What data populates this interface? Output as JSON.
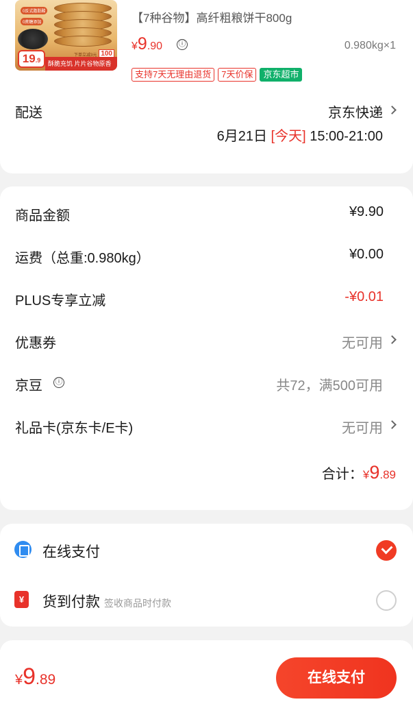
{
  "product": {
    "title": "【7种谷物】高纤粗粮饼干800g",
    "price_symbol": "¥",
    "price_int": "9",
    "price_dec": ".90",
    "weight_qty": "0.980kg×1",
    "tags": [
      "支持7天无理由退货",
      "7天价保",
      "京东超市"
    ],
    "image": {
      "badge_int": "19",
      "badge_dec": ".9",
      "promo_small": "下单立减3元",
      "promo_100": "100",
      "promo_bar": "酥脆充饥 片片谷物原香",
      "tag1": "0反式脂肪酸",
      "tag2": "0蔗糖添加"
    }
  },
  "delivery": {
    "label": "配送",
    "carrier": "京东快递",
    "date": "6月21日",
    "today": "[今天]",
    "window": "15:00-21:00"
  },
  "summary": {
    "rows": [
      {
        "label": "商品金额",
        "value": "¥9.90"
      },
      {
        "label": "运费（总重:0.980kg）",
        "value": "¥0.00"
      },
      {
        "label": "PLUS专享立减",
        "value": "-¥0.01"
      },
      {
        "label": "优惠券",
        "value": "无可用"
      },
      {
        "label": "京豆",
        "value": "共72，满500可用"
      },
      {
        "label": "礼品卡(京东卡/E卡)",
        "value": "无可用"
      }
    ],
    "total_label": "合计：",
    "total_symbol": "¥",
    "total_int": "9",
    "total_dec": ".89"
  },
  "payment": {
    "online_label": "在线支付",
    "cod_label": "货到付款",
    "cod_sub": "签收商品时付款",
    "cod_icon": "¥",
    "selected": "online"
  },
  "footer": {
    "price_symbol": "¥",
    "price_int": "9",
    "price_dec": ".89",
    "button_label": "在线支付"
  },
  "colors": {
    "accent": "#e8322a",
    "green_tag": "#10b06a",
    "online_icon": "#2f8cf0"
  },
  "icons": {
    "info": "ⓘ",
    "chevron": "chevron-right-icon"
  }
}
